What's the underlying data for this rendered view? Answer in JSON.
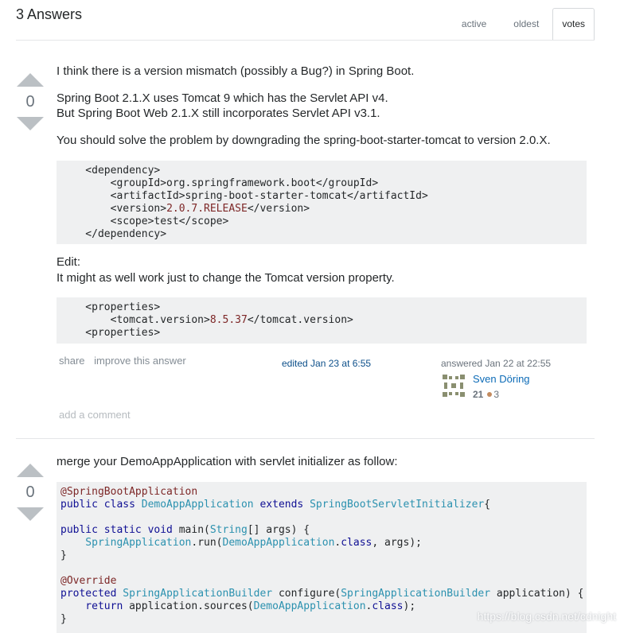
{
  "header": {
    "title": "3 Answers",
    "tabs": [
      "active",
      "oldest",
      "votes"
    ]
  },
  "answer1": {
    "votes": "0",
    "para1": "I think there is a version mismatch (possibly a Bug?) in Spring Boot.",
    "para2a": "Spring Boot 2.1.X uses Tomcat 9 which has the Servlet API v4.",
    "para2b": "But Spring Boot Web 2.1.X still incorporates Servlet API v3.1.",
    "para3": "You should solve the problem by downgrading the spring-boot-starter-tomcat to version 2.0.X.",
    "code1": {
      "l1": "    <dependency>",
      "l2a": "        <groupId>org.springframework.boot</groupId>",
      "l3a": "        <artifactId>spring-boot-starter-tomcat</artifactId>",
      "l4a": "        <version>",
      "l4b": "2.0.7.RELEASE",
      "l4c": "</version>",
      "l5a": "        <scope>test</scope>",
      "l6": "    </dependency>"
    },
    "edit_label": "Edit:",
    "edit_text": "It might as well work just to change the Tomcat version property.",
    "code2": {
      "l1": "    <properties>",
      "l2a": "        <tomcat.version>",
      "l2b": "8.5.37",
      "l2c": "</tomcat.version>",
      "l3": "    <properties>"
    },
    "menu": {
      "share": "share",
      "improve": "improve this answer"
    },
    "edited": "edited Jan 23 at 6:55",
    "answered": "answered Jan 22 at 22:55",
    "user": {
      "name": "Sven Döring",
      "rep": "21",
      "bronze": "3"
    },
    "add_comment": "add a comment"
  },
  "answer2": {
    "votes": "0",
    "para1": "merge your DemoAppApplication with servlet initializer as follow:",
    "code": {
      "l1": "@SpringBootApplication",
      "l2kw1": "public class ",
      "l2ty1": "DemoAppApplication",
      "l2kw2": " extends ",
      "l2ty2": "SpringBootServletInitializer",
      "l2e": "{",
      "l4kw": "public static void ",
      "l4a": "main(",
      "l4ty": "String",
      "l4b": "[] args) {",
      "l5ty": "    SpringApplication",
      "l5a": ".run(",
      "l5ty2": "DemoAppApplication",
      "l5b": ".",
      "l5kw": "class",
      "l5c": ", args);",
      "l6": "}",
      "l8": "@Override",
      "l9kw": "protected ",
      "l9ty": "SpringApplicationBuilder",
      "l9a": " configure(",
      "l9ty2": "SpringApplicationBuilder",
      "l9b": " application) {",
      "l10kw": "    return ",
      "l10a": "application.sources(",
      "l10ty": "DemoAppApplication",
      "l10b": ".",
      "l10kw2": "class",
      "l10c": ");",
      "l11": "}"
    }
  },
  "watermark": "https://blog.csdn.net/cdnight",
  "colors": {
    "link": "#0c6bb7",
    "code_bg": "#eff0f1",
    "vote_arrow": "#bbc0c4"
  }
}
